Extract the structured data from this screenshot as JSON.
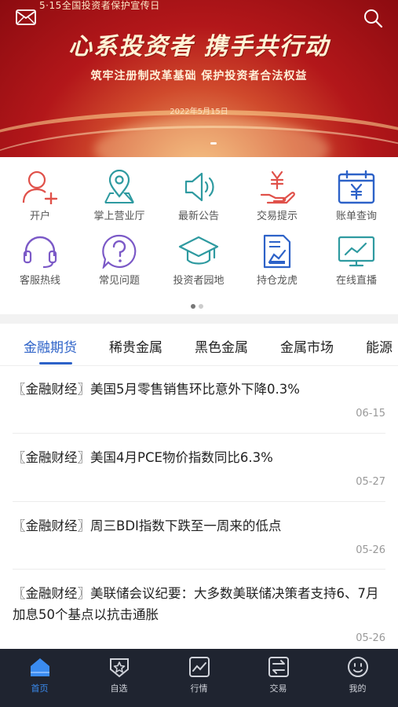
{
  "banner": {
    "top_text": "5·15全国投资者保护宣传日",
    "slogan": "心系投资者  携手共行动",
    "subtitle": "筑牢注册制改革基础  保护投资者合法权益",
    "date": "2022年5月15日",
    "mail_icon": "mail-icon",
    "search_icon": "search-icon"
  },
  "quick_menu": [
    {
      "label": "开户",
      "icon": "add-user-icon"
    },
    {
      "label": "掌上营业厅",
      "icon": "location-pin-icon"
    },
    {
      "label": "最新公告",
      "icon": "speaker-icon"
    },
    {
      "label": "交易提示",
      "icon": "yen-hand-icon"
    },
    {
      "label": "账单查询",
      "icon": "yen-calendar-icon"
    },
    {
      "label": "客服热线",
      "icon": "headset-icon"
    },
    {
      "label": "常见问题",
      "icon": "question-icon"
    },
    {
      "label": "投资者园地",
      "icon": "graduation-cap-icon"
    },
    {
      "label": "持仓龙虎",
      "icon": "chart-document-icon"
    },
    {
      "label": "在线直播",
      "icon": "monitor-chart-icon"
    }
  ],
  "tabs": [
    "金融期货",
    "稀贵金属",
    "黑色金属",
    "金属市场",
    "能源"
  ],
  "active_tab": "金融期货",
  "news": [
    {
      "title": "〖金融财经〗美国5月零售销售环比意外下降0.3%",
      "date": "06-15"
    },
    {
      "title": "〖金融财经〗美国4月PCE物价指数同比6.3%",
      "date": "05-27"
    },
    {
      "title": "〖金融财经〗周三BDI指数下跌至一周来的低点",
      "date": "05-26"
    },
    {
      "title": "〖金融财经〗美联储会议纪要：大多数美联储决策者支持6、7月加息50个基点以抗击通胀",
      "date": "05-26"
    }
  ],
  "bottom_nav": [
    {
      "label": "首页",
      "icon": "home-icon"
    },
    {
      "label": "自选",
      "icon": "star-shield-icon"
    },
    {
      "label": "行情",
      "icon": "chart-icon"
    },
    {
      "label": "交易",
      "icon": "exchange-icon"
    },
    {
      "label": "我的",
      "icon": "profile-icon"
    }
  ],
  "colors": {
    "accent": "#2d62c8",
    "icon_red": "#e0514a",
    "icon_teal": "#2e9aa0",
    "icon_purple": "#7b59c7",
    "icon_blue": "#2d62c8",
    "nav_bg": "#1f2430"
  }
}
